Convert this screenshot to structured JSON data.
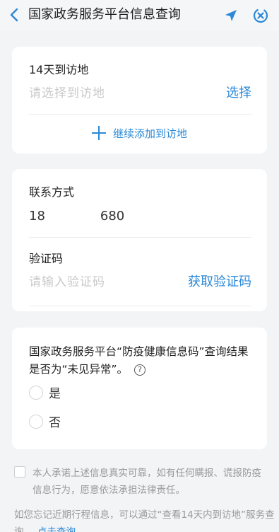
{
  "header": {
    "title": "国家政务服务平台信息查询",
    "back_icon": "chevron-left-icon",
    "location_icon": "location-arrow-icon",
    "close_icon": "close-circle-icon"
  },
  "visit_card": {
    "label": "14天到访地",
    "placeholder": "请选择到访地",
    "select_label": "选择",
    "add_label": "继续添加到访地"
  },
  "contact_card": {
    "contact_label": "联系方式",
    "phone_prefix": "18",
    "phone_suffix": "680",
    "code_label": "验证码",
    "code_placeholder": "请输入验证码",
    "get_code_label": "获取验证码"
  },
  "question_card": {
    "question": "国家政务服务平台“防疫健康信息码”查询结果是否为“未见异常”。",
    "help_icon": "?",
    "options": [
      "是",
      "否"
    ]
  },
  "promise": {
    "text": "本人承诺上述信息真实可靠，如有任何瞒报、谎报防疫信息行为，愿意依法承担法律责任。"
  },
  "footnote": {
    "text": "如您忘记近期行程信息，可以通过“查看14天内到访地”服务查询。",
    "link_label": "点击查询"
  },
  "colors": {
    "accent": "#2a88d6",
    "background": "#f3f4f6",
    "card": "#ffffff"
  }
}
